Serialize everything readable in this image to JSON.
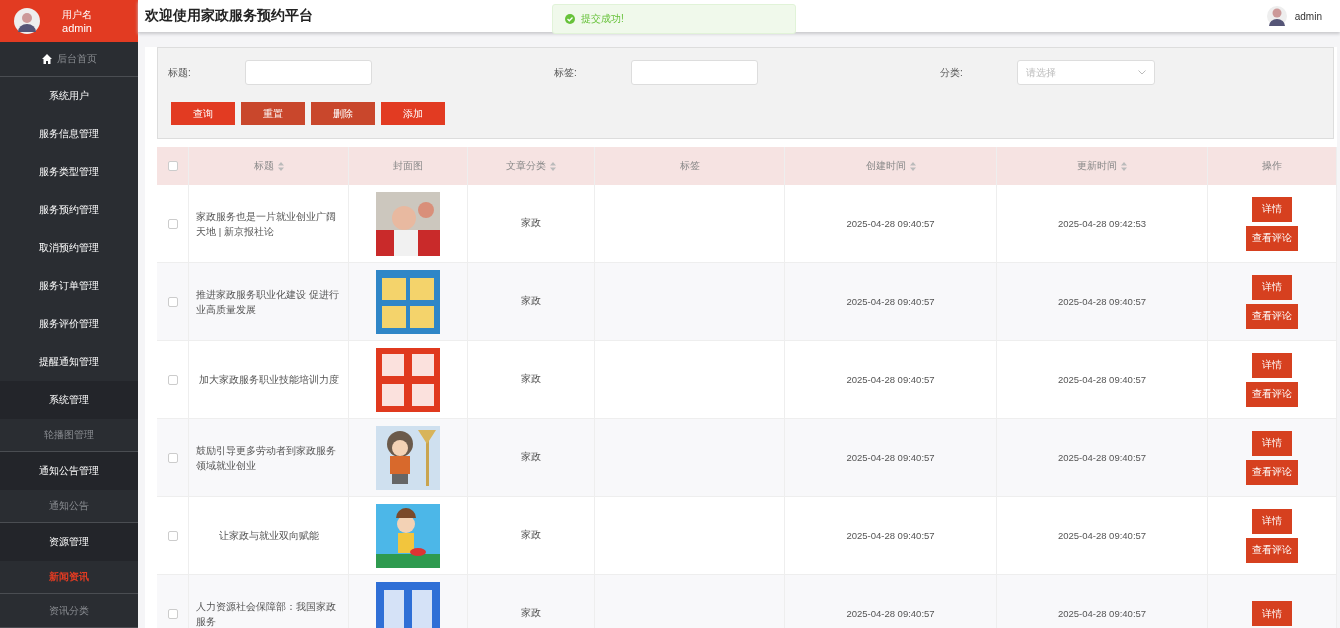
{
  "sidebar": {
    "user_label": "用户名",
    "user_name": "admin",
    "items": [
      {
        "kind": "home",
        "label": "后台首页",
        "selected": false
      },
      {
        "kind": "menu",
        "label": "系统用户",
        "selected": false
      },
      {
        "kind": "menu",
        "label": "服务信息管理",
        "selected": false
      },
      {
        "kind": "menu",
        "label": "服务类型管理",
        "selected": false
      },
      {
        "kind": "menu",
        "label": "服务预约管理",
        "selected": false
      },
      {
        "kind": "menu",
        "label": "取消预约管理",
        "selected": false
      },
      {
        "kind": "menu",
        "label": "服务订单管理",
        "selected": false
      },
      {
        "kind": "menu",
        "label": "服务评价管理",
        "selected": false
      },
      {
        "kind": "menu",
        "label": "提醒通知管理",
        "selected": false
      },
      {
        "kind": "group",
        "label": "系统管理",
        "selected": false
      },
      {
        "kind": "sub",
        "label": "轮播图管理",
        "selected": false
      },
      {
        "kind": "group",
        "label": "通知公告管理",
        "selected": false
      },
      {
        "kind": "sub",
        "label": "通知公告",
        "selected": false
      },
      {
        "kind": "group",
        "label": "资源管理",
        "selected": false
      },
      {
        "kind": "sub",
        "label": "新闻资讯",
        "selected": true
      },
      {
        "kind": "sub",
        "label": "资讯分类",
        "selected": false
      }
    ]
  },
  "header": {
    "title": "欢迎使用家政服务预约平台",
    "user_name": "admin"
  },
  "toast": {
    "kind": "success",
    "message": "提交成功!"
  },
  "filters": {
    "fields": [
      {
        "kind": "text",
        "label": "标题:"
      },
      {
        "kind": "text",
        "label": "标签:"
      },
      {
        "kind": "select",
        "label": "分类:",
        "placeholder": "请选择"
      }
    ],
    "buttons": [
      "查询",
      "重置",
      "删除",
      "添加"
    ]
  },
  "table": {
    "select_all_checked": false,
    "columns": [
      {
        "label": "标题",
        "sortable": true
      },
      {
        "label": "封面图",
        "sortable": false
      },
      {
        "label": "文章分类",
        "sortable": true
      },
      {
        "label": "标签",
        "sortable": false
      },
      {
        "label": "创建时间",
        "sortable": true
      },
      {
        "label": "更新时间",
        "sortable": true
      },
      {
        "label": "操作",
        "sortable": false
      }
    ],
    "rows": [
      {
        "checked": false,
        "title": "家政服务也是一片就业创业广阔天地 | 新京报社论",
        "cover": {
          "kind": "picture"
        },
        "category": "家政",
        "created": "2025-04-28 09:40:57",
        "updated": "2025-04-28 09:42:53",
        "actions": [
          "详情",
          "查看评论"
        ]
      },
      {
        "checked": false,
        "title": "推进家政服务职业化建设 促进行业高质量发展",
        "cover": {
          "kind": "picture"
        },
        "category": "家政",
        "created": "2025-04-28 09:40:57",
        "updated": "2025-04-28 09:40:57",
        "actions": [
          "详情",
          "查看评论"
        ]
      },
      {
        "checked": false,
        "title": "加大家政服务职业技能培训力度",
        "cover": {
          "kind": "picture"
        },
        "category": "家政",
        "created": "2025-04-28 09:40:57",
        "updated": "2025-04-28 09:40:57",
        "actions": [
          "详情",
          "查看评论"
        ]
      },
      {
        "checked": false,
        "title": "鼓励引导更多劳动者到家政服务领域就业创业",
        "cover": {
          "kind": "picture"
        },
        "category": "家政",
        "created": "2025-04-28 09:40:57",
        "updated": "2025-04-28 09:40:57",
        "actions": [
          "详情",
          "查看评论"
        ]
      },
      {
        "checked": false,
        "title": "让家政与就业双向赋能",
        "cover": {
          "kind": "picture"
        },
        "category": "家政",
        "created": "2025-04-28 09:40:57",
        "updated": "2025-04-28 09:40:57",
        "actions": [
          "详情",
          "查看评论"
        ]
      },
      {
        "checked": false,
        "title": "人力资源社会保障部：我国家政服务",
        "cover": {
          "kind": "picture"
        },
        "category": "家政",
        "created": "2025-04-28 09:40:57",
        "updated": "2025-04-28 09:40:57",
        "actions": [
          "详情"
        ]
      }
    ]
  }
}
